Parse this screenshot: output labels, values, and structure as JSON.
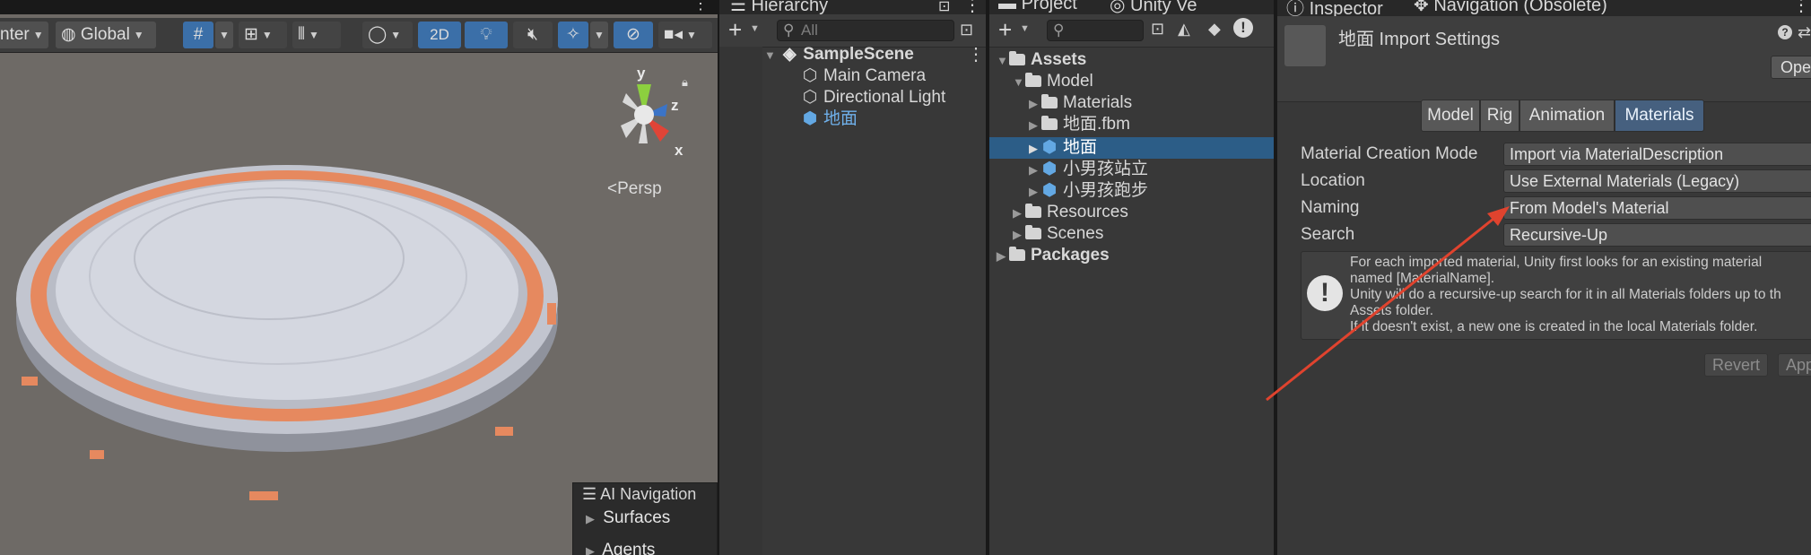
{
  "scene": {
    "toolbar": {
      "pivot_label": "nter",
      "space_label": "Global",
      "mode_2d": "2D",
      "persp_label": "Persp"
    },
    "gizmo": {
      "y": "y",
      "z": "z",
      "x": "x"
    },
    "ai_navigation": {
      "title": "AI Navigation",
      "items": [
        "Surfaces",
        "Agents"
      ]
    }
  },
  "hierarchy": {
    "tab": "Hierarchy",
    "search_placeholder": "All",
    "scene_name": "SampleScene",
    "items": [
      "Main Camera",
      "Directional Light",
      "地面"
    ]
  },
  "project": {
    "tabs": [
      "Project",
      "Unity Ve"
    ],
    "tree": {
      "assets": "Assets",
      "model": "Model",
      "materials": "Materials",
      "fbm": "地面.fbm",
      "selected": "地面",
      "child1": "小男孩站立",
      "child2": "小男孩跑步",
      "resources": "Resources",
      "scenes": "Scenes",
      "packages": "Packages"
    }
  },
  "inspector": {
    "tabs": [
      "Inspector",
      "Navigation (Obsolete)"
    ],
    "title": "地面 Import Settings",
    "open_button": "Ope",
    "segments": [
      "Model",
      "Rig",
      "Animation",
      "Materials"
    ],
    "selected_segment": "Materials",
    "properties": [
      {
        "label": "Material Creation Mode",
        "value": "Import via MaterialDescription"
      },
      {
        "label": "Location",
        "value": "Use External Materials (Legacy)"
      },
      {
        "label": "Naming",
        "value": "From Model's Material"
      },
      {
        "label": "Search",
        "value": "Recursive-Up"
      }
    ],
    "help_text": "For each imported material, Unity first looks for an existing material\nnamed [MaterialName].\nUnity will do a recursive-up search for it in all Materials folders up to th\nAssets folder.\nIf it doesn't exist, a new one is created in the local Materials folder.",
    "revert_button": "Revert",
    "apply_button": "App"
  },
  "colors": {
    "selection": "#2c5d87",
    "accent_arrow": "#e0432e",
    "ring_orange": "#e6895f"
  }
}
